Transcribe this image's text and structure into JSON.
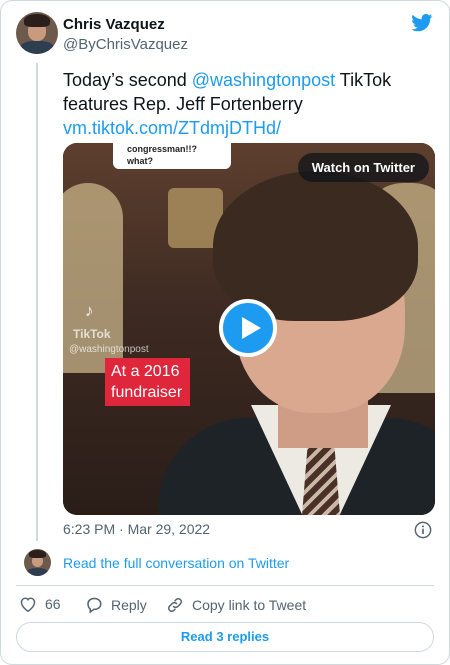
{
  "author": {
    "name": "Chris Vazquez",
    "handle": "@ByChrisVazquez"
  },
  "tweet": {
    "text_part1": "Today’s second ",
    "mention": "@washingtonpost",
    "text_part2": " TikTok features Rep. Jeff Fortenberry",
    "link": "vm.tiktok.com/ZTdmjDTHd/"
  },
  "media": {
    "speech_bubble": "congressman!!?\nwhat?",
    "watch_label": "Watch on Twitter",
    "tiktok_word": "TikTok",
    "tiktok_handle": "@washingtonpost",
    "caption": "At a 2016 fundraiser"
  },
  "timestamp": "6:23 PM · Mar 29, 2022",
  "read_conversation": "Read the full conversation on Twitter",
  "actions": {
    "likes_count": "66",
    "reply_label": "Reply",
    "copy_label": "Copy link to Tweet"
  },
  "read_replies": "Read 3 replies",
  "colors": {
    "accent": "#1d9bf0",
    "muted": "#536471",
    "border": "#cfd9de",
    "caption_red": "#e0263a"
  }
}
